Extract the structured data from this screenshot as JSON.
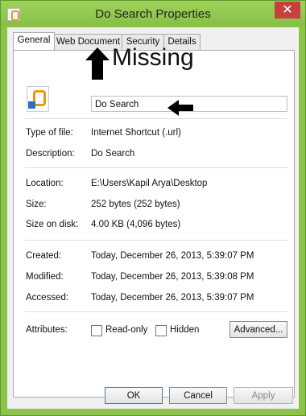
{
  "window": {
    "title": "Do Search Properties",
    "close_label": "✕"
  },
  "tabs": [
    {
      "label": "General",
      "active": true
    },
    {
      "label": "Web Document",
      "active": false
    },
    {
      "label": "Security",
      "active": false
    },
    {
      "label": "Details",
      "active": false
    }
  ],
  "general": {
    "file_name": "Do Search",
    "rows": {
      "type_label": "Type of file:",
      "type_value": "Internet Shortcut (.url)",
      "desc_label": "Description:",
      "desc_value": "Do Search",
      "location_label": "Location:",
      "location_value": "E:\\Users\\Kapil Arya\\Desktop",
      "size_label": "Size:",
      "size_value": "252 bytes (252 bytes)",
      "size_disk_label": "Size on disk:",
      "size_disk_value": "4.00 KB (4,096 bytes)",
      "created_label": "Created:",
      "created_value": "Today, December 26, 2013, 5:39:07 PM",
      "modified_label": "Modified:",
      "modified_value": "Today, December 26, 2013, 5:39:08 PM",
      "accessed_label": "Accessed:",
      "accessed_value": "Today, December 26, 2013, 5:39:07 PM"
    },
    "attributes": {
      "label": "Attributes:",
      "read_only": "Read-only",
      "hidden": "Hidden",
      "advanced": "Advanced..."
    }
  },
  "annotation": {
    "missing": "Missing"
  },
  "buttons": {
    "ok": "OK",
    "cancel": "Cancel",
    "apply": "Apply"
  }
}
